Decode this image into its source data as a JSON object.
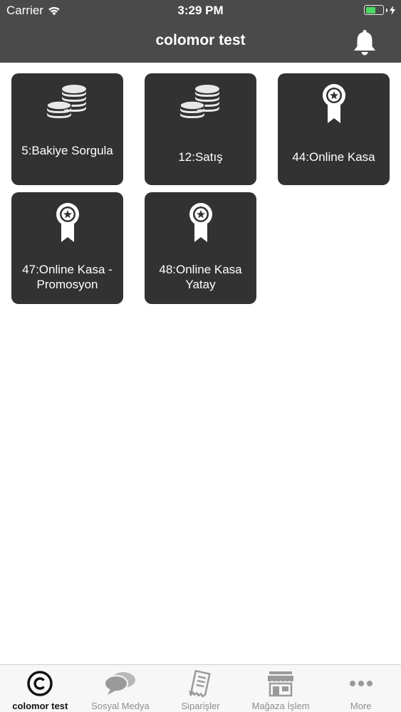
{
  "status_bar": {
    "carrier": "Carrier",
    "time": "3:29 PM"
  },
  "nav": {
    "title": "colomor test",
    "bell_icon": "bell-icon"
  },
  "tiles": [
    {
      "label": "5:Bakiye Sorgula",
      "icon": "coins-icon"
    },
    {
      "label": "12:Satış",
      "icon": "coins-icon"
    },
    {
      "label": "44:Online Kasa",
      "icon": "award-ribbon-icon"
    },
    {
      "label": "47:Online Kasa - Promosyon",
      "icon": "award-ribbon-icon"
    },
    {
      "label": "48:Online Kasa Yatay",
      "icon": "award-ribbon-icon"
    }
  ],
  "tab_bar": {
    "items": [
      {
        "label": "colomor test",
        "icon": "copyright-icon",
        "active": true
      },
      {
        "label": "Sosyal Medya",
        "icon": "chat-bubbles-icon",
        "active": false
      },
      {
        "label": "Siparişler",
        "icon": "receipt-icon",
        "active": false
      },
      {
        "label": "Mağaza İşlem",
        "icon": "store-icon",
        "active": false
      },
      {
        "label": "More",
        "icon": "more-dots-icon",
        "active": false
      }
    ]
  },
  "colors": {
    "nav_background": "#4a4a4a",
    "tile_background": "#333232",
    "battery": "#4cd964",
    "tab_active": "#111111",
    "tab_inactive": "#8e8e8e"
  }
}
